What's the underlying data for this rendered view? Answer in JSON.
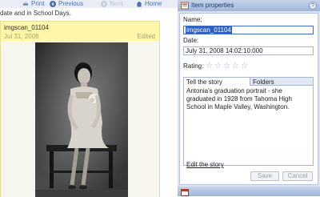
{
  "toolbar": {
    "print": "Print",
    "previous": "Previous",
    "next": "Next",
    "home": "Home"
  },
  "subtitle": "date and in School Days.",
  "card": {
    "title": "imgscan_01104",
    "date": "Jul 31, 2008",
    "status": "Edited"
  },
  "panel": {
    "title": "Item properties",
    "help": "?",
    "name_label": "Name:",
    "name_value": "imgscan_01104",
    "date_label": "Date:",
    "date_value": "July 31, 2008 14:02:10:000",
    "rating_label": "Rating:",
    "rating_value": 0,
    "rating_max": 5,
    "tabs": [
      "Tell the story",
      "Folders"
    ],
    "story": "Antonia's graduation portrait - she graduated in 1928 from Tahoma High School in Maple Valley, Washington.",
    "edit_link": "Edit the story",
    "save": "Save",
    "cancel": "Cancel"
  },
  "colors": {
    "accent": "#4a73b0",
    "card_header": "#fdf7a7",
    "panel_bg": "#dbe4f1",
    "selection": "#2f5fbe"
  }
}
